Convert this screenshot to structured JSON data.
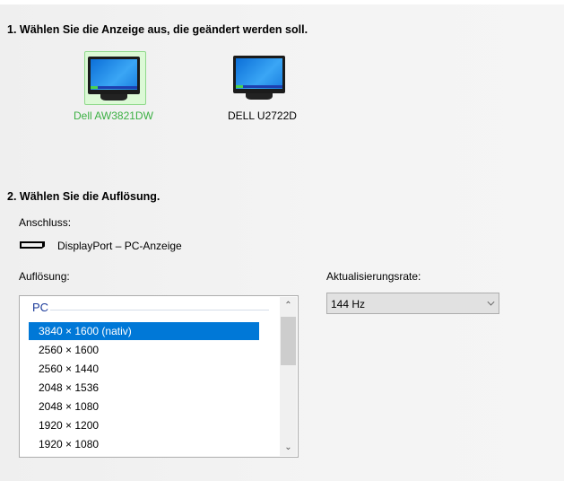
{
  "step1": {
    "title": "1. Wählen Sie die Anzeige aus, die geändert werden soll.",
    "displays": [
      {
        "name": "Dell AW3821DW",
        "selected": true
      },
      {
        "name": "DELL U2722D",
        "selected": false
      }
    ]
  },
  "step2": {
    "title": "2. Wählen Sie die Auflösung.",
    "connection_label": "Anschluss:",
    "connection_value": "DisplayPort – PC-Anzeige",
    "resolution_label": "Auflösung:",
    "group": "PC",
    "resolutions": [
      "3840 × 1600 (nativ)",
      "2560 × 1600",
      "2560 × 1440",
      "2048 × 1536",
      "2048 × 1080",
      "1920 × 1200",
      "1920 × 1080"
    ],
    "refresh_label": "Aktualisierungsrate:",
    "refresh_value": "144 Hz"
  },
  "colors": {
    "accent": "#0078d7",
    "selected_display": "#3cb043"
  }
}
